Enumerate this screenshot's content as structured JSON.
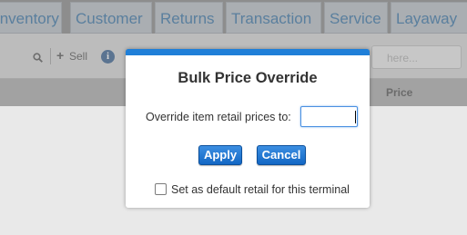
{
  "nav": {
    "tabs": [
      {
        "label": "Inventory"
      },
      {
        "label": "Customer"
      },
      {
        "label": "Returns"
      },
      {
        "label": "Transaction"
      },
      {
        "label": "Service"
      },
      {
        "label": "Layaway"
      }
    ]
  },
  "toolbar": {
    "sell_label": "Sell",
    "info_glyph": "i",
    "search_placeholder": "here..."
  },
  "table": {
    "columns": {
      "price": "Price"
    }
  },
  "dialog": {
    "title": "Bulk Price Override",
    "field_label": "Override item retail prices to:",
    "field_value": "",
    "apply_label": "Apply",
    "cancel_label": "Cancel",
    "default_checkbox_label": "Set as default retail for this terminal",
    "default_checked": false,
    "accent_color": "#1f7fd8"
  }
}
